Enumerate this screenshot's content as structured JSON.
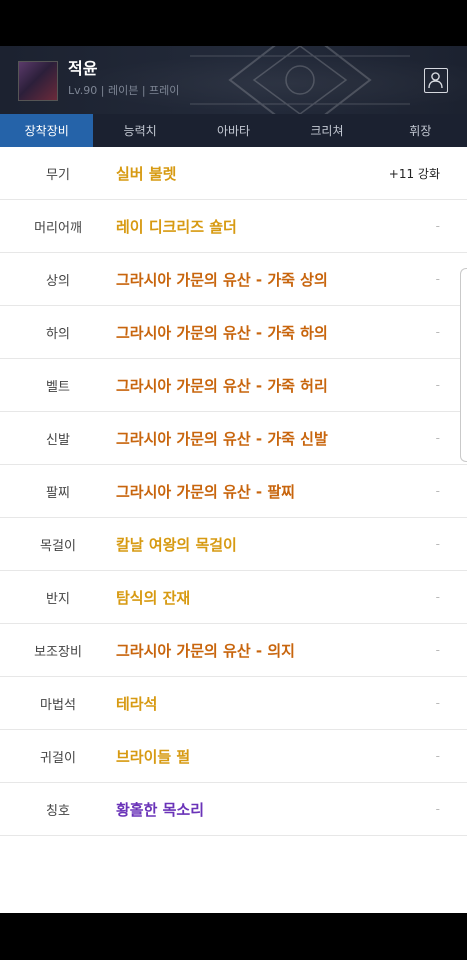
{
  "character": {
    "name": "적윤",
    "info": "Lv.90 | 레이븐 | 프레이"
  },
  "tabs": [
    {
      "label": "장착장비",
      "active": true
    },
    {
      "label": "능력치",
      "active": false
    },
    {
      "label": "아바타",
      "active": false
    },
    {
      "label": "크리쳐",
      "active": false
    },
    {
      "label": "휘장",
      "active": false
    }
  ],
  "equipment": [
    {
      "slot": "무기",
      "item": "실버 불렛",
      "color": "#d79a12",
      "extra": "+11 강화"
    },
    {
      "slot": "머리어깨",
      "item": "레이 디크리즈 숄더",
      "color": "#d79a12",
      "extra": "-"
    },
    {
      "slot": "상의",
      "item": "그라시아 가문의 유산 - 가죽 상의",
      "color": "#c8650d",
      "extra": "-"
    },
    {
      "slot": "하의",
      "item": "그라시아 가문의 유산 - 가죽 하의",
      "color": "#c8650d",
      "extra": "-"
    },
    {
      "slot": "벨트",
      "item": "그라시아 가문의 유산 - 가죽 허리",
      "color": "#c8650d",
      "extra": "-"
    },
    {
      "slot": "신발",
      "item": "그라시아 가문의 유산 - 가죽 신발",
      "color": "#c8650d",
      "extra": "-"
    },
    {
      "slot": "팔찌",
      "item": "그라시아 가문의 유산 - 팔찌",
      "color": "#c8650d",
      "extra": "-"
    },
    {
      "slot": "목걸이",
      "item": "칼날 여왕의 목걸이",
      "color": "#d79a12",
      "extra": "-"
    },
    {
      "slot": "반지",
      "item": "탐식의 잔재",
      "color": "#d79a12",
      "extra": "-"
    },
    {
      "slot": "보조장비",
      "item": "그라시아 가문의 유산 - 의지",
      "color": "#c8650d",
      "extra": "-"
    },
    {
      "slot": "마법석",
      "item": "테라석",
      "color": "#d79a12",
      "extra": "-"
    },
    {
      "slot": "귀걸이",
      "item": "브라이들 펄",
      "color": "#d79a12",
      "extra": "-"
    },
    {
      "slot": "칭호",
      "item": "황홀한 목소리",
      "color": "#6a33b8",
      "extra": "-"
    }
  ]
}
